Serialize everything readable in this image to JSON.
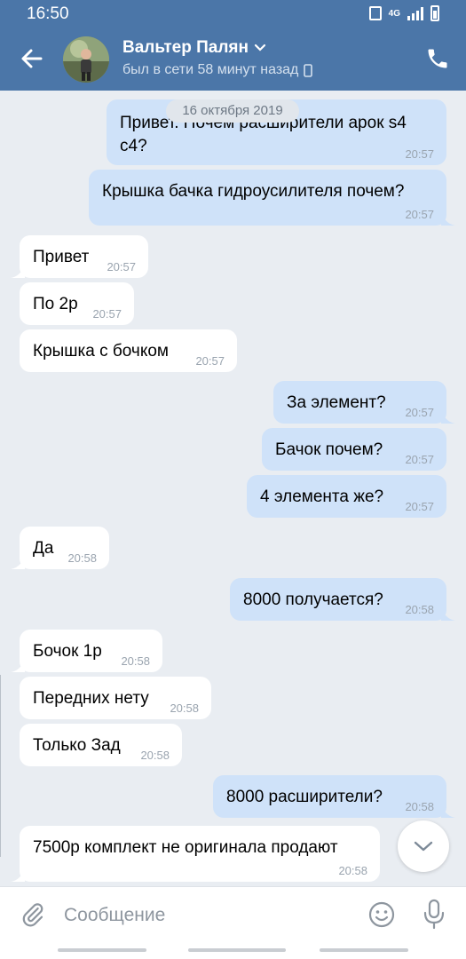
{
  "status_bar": {
    "time": "16:50",
    "network_label": "4G"
  },
  "header": {
    "back_icon": "arrow-left-icon",
    "contact_name": "Вальтер Палян",
    "contact_status": "был в сети 58 минут назад",
    "phone_icon": "phone-icon"
  },
  "date_separator": "16 октября 2019",
  "messages": [
    {
      "dir": "out",
      "line1": "Привет. Почем расширители арок s4",
      "line2": "c4?",
      "time": "20:57"
    },
    {
      "dir": "out",
      "text": "Крышка бачка гидроусилителя почем?",
      "time": "20:57"
    },
    {
      "dir": "in",
      "text": "Привет",
      "time": "20:57"
    },
    {
      "dir": "in",
      "text": "По 2р",
      "time": "20:57"
    },
    {
      "dir": "in",
      "text": "Крышка с бочком",
      "time": "20:57"
    },
    {
      "dir": "out",
      "text": "За элемент?",
      "time": "20:57"
    },
    {
      "dir": "out",
      "text": "Бачок почем?",
      "time": "20:57"
    },
    {
      "dir": "out",
      "text": "4 элемента же?",
      "time": "20:57"
    },
    {
      "dir": "in",
      "text": "Да",
      "time": "20:58"
    },
    {
      "dir": "out",
      "text": "8000 получается?",
      "time": "20:58"
    },
    {
      "dir": "in",
      "text": "Бочок 1р",
      "time": "20:58"
    },
    {
      "dir": "in",
      "text": "Передних нету",
      "time": "20:58"
    },
    {
      "dir": "in",
      "text": "Только Зад",
      "time": "20:58"
    },
    {
      "dir": "out",
      "text": "8000 расширители?",
      "time": "20:58"
    },
    {
      "dir": "in",
      "text": "7500р комплект не оригинала продают",
      "time": "20:58"
    }
  ],
  "composer": {
    "placeholder": "Сообщение",
    "attach_icon": "paperclip-icon",
    "emoji_icon": "smile-icon",
    "mic_icon": "microphone-icon"
  },
  "colors": {
    "header": "#4b76a8",
    "background": "#e9edf2",
    "outgoing_bubble": "#cfe2f9",
    "incoming_bubble": "#ffffff"
  }
}
